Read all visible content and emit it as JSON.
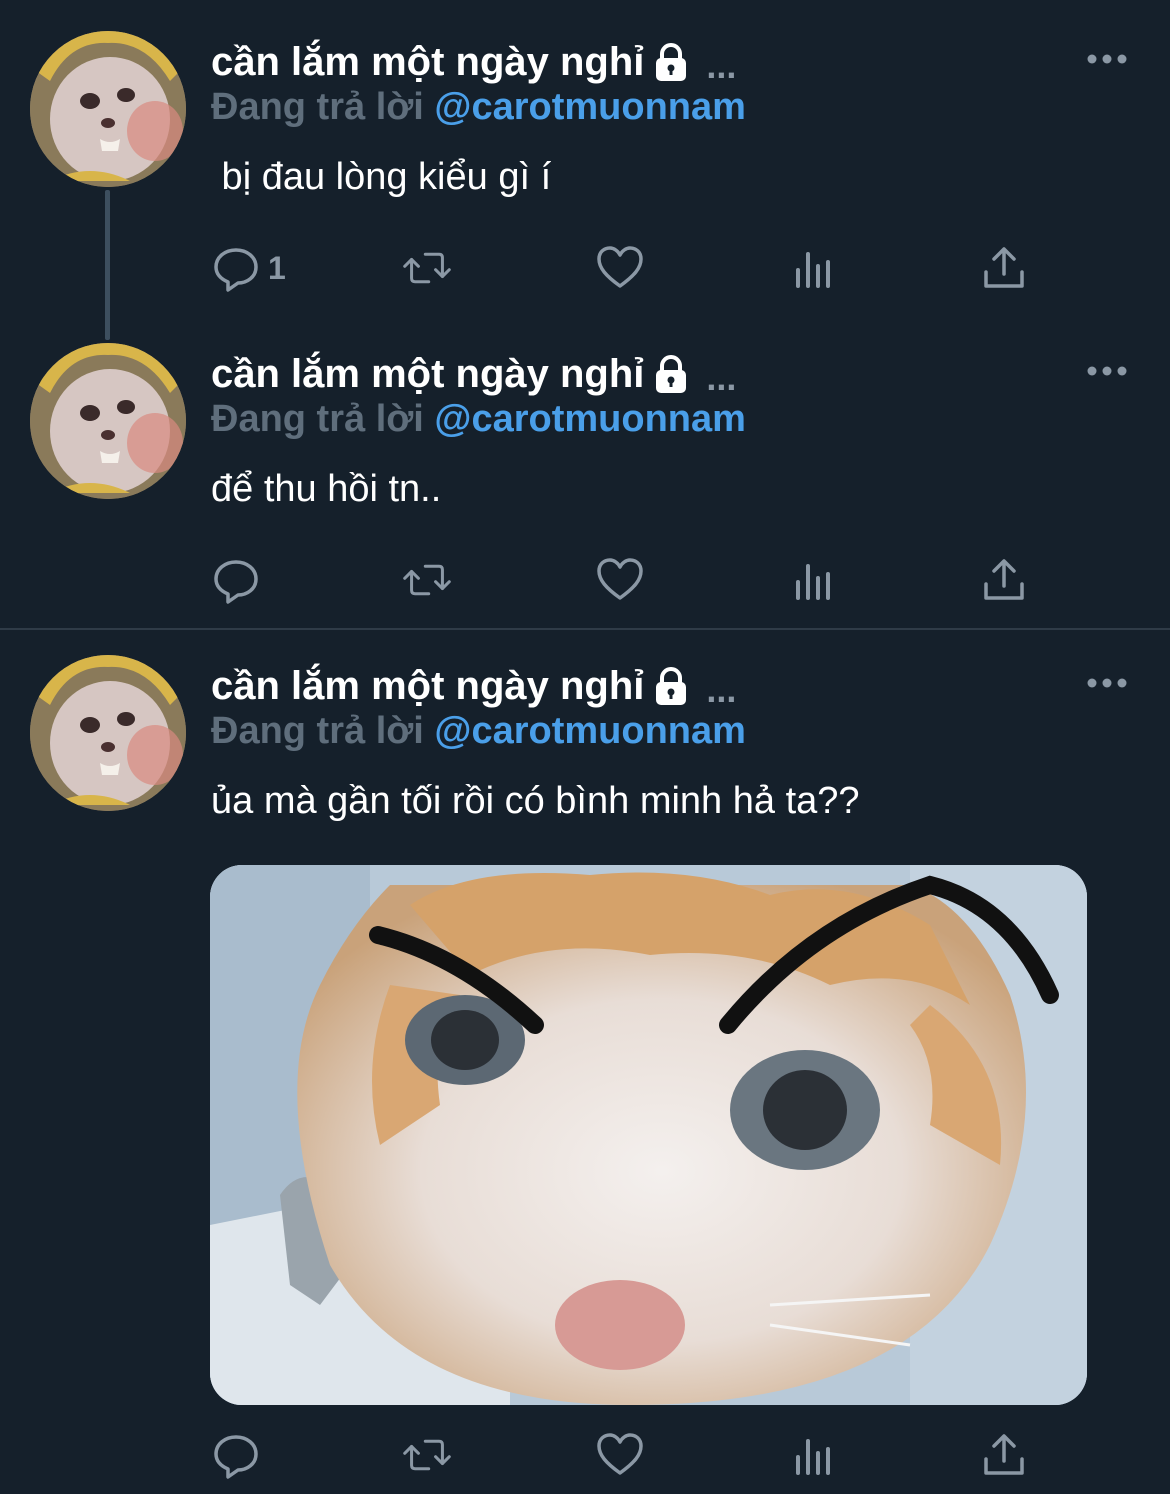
{
  "tweets": [
    {
      "display_name": "cần lắm một ngày nghỉ",
      "name_suffix": "...",
      "reply_label": "Đang trả lời",
      "reply_handle": "@carotmuonnam",
      "text": " bị đau lòng kiểu gì í",
      "reply_count": "1"
    },
    {
      "display_name": "cần lắm một ngày nghỉ",
      "name_suffix": "...",
      "reply_label": "Đang trả lời",
      "reply_handle": "@carotmuonnam",
      "text": "để thu hồi tn..",
      "reply_count": ""
    },
    {
      "display_name": "cần lắm một ngày nghỉ",
      "name_suffix": "...",
      "reply_label": "Đang trả lời",
      "reply_handle": "@carotmuonnam",
      "text": "ủa mà gần tối rồi có bình minh hả ta??",
      "reply_count": "",
      "media": "cat-photo-with-drawn-eyebrows"
    }
  ],
  "icons": {
    "lock": "lock-icon",
    "more": "more-icon",
    "reply": "reply-icon",
    "retweet": "retweet-icon",
    "like": "heart-icon",
    "analytics": "analytics-icon",
    "share": "share-icon"
  },
  "colors": {
    "background": "#15202b",
    "handle": "#4a9fe9",
    "muted": "#8b98a5",
    "reply_label": "#5f6e7c"
  }
}
